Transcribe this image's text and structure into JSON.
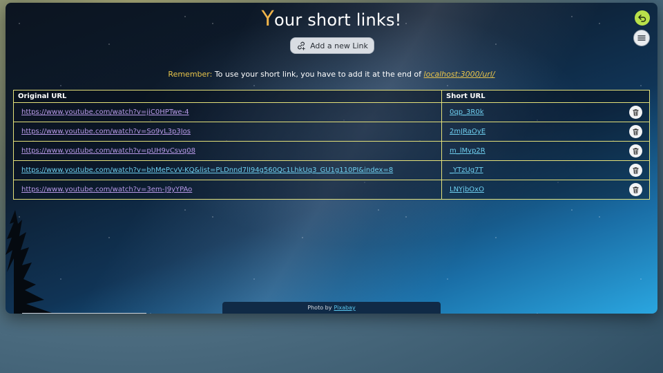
{
  "header": {
    "title_first_letter": "Y",
    "title_rest": "our short links!",
    "add_button_label": "Add a new Link"
  },
  "notice": {
    "label": "Remember:",
    "text": " To use your short link, you have to add it at the end of ",
    "host": "localhost:3000/url/"
  },
  "table": {
    "columns": [
      "Original URL",
      "Short URL"
    ],
    "rows": [
      {
        "original": "https://www.youtube.com/watch?v=jiC0HPTwe-4",
        "short": "0qp_3R0k"
      },
      {
        "original": "https://www.youtube.com/watch?v=So9yL3p3Jos",
        "short": "2mJRaOyE"
      },
      {
        "original": "https://www.youtube.com/watch?v=pUH9vCsvq08",
        "short": "m_lMvp2R"
      },
      {
        "original": "https://www.youtube.com/watch?v=bhMePcvV-KQ&list=PLDnnd7lI94g560Qc1LhkUq3_GU1g110PI&index=8",
        "short": "_YTzUg7T"
      },
      {
        "original": "https://www.youtube.com/watch?v=3em-J9yYPAo",
        "short": "LNYjbOxO"
      }
    ]
  },
  "footer": {
    "credit_prefix": "Photo by",
    "credit_link": "Pixabay"
  },
  "icons": {
    "back": "undo-arrow-icon",
    "menu": "hamburger-menu-icon",
    "add": "link-add-icon",
    "delete": "trash-icon"
  },
  "colors": {
    "accent_yellow": "#e8c44a",
    "title_y": "#f0b44a",
    "table_border": "#e6e27a",
    "short_link": "#6fd0f0",
    "visited_link": "#b89ae8",
    "back_button": "#b8e04a"
  }
}
